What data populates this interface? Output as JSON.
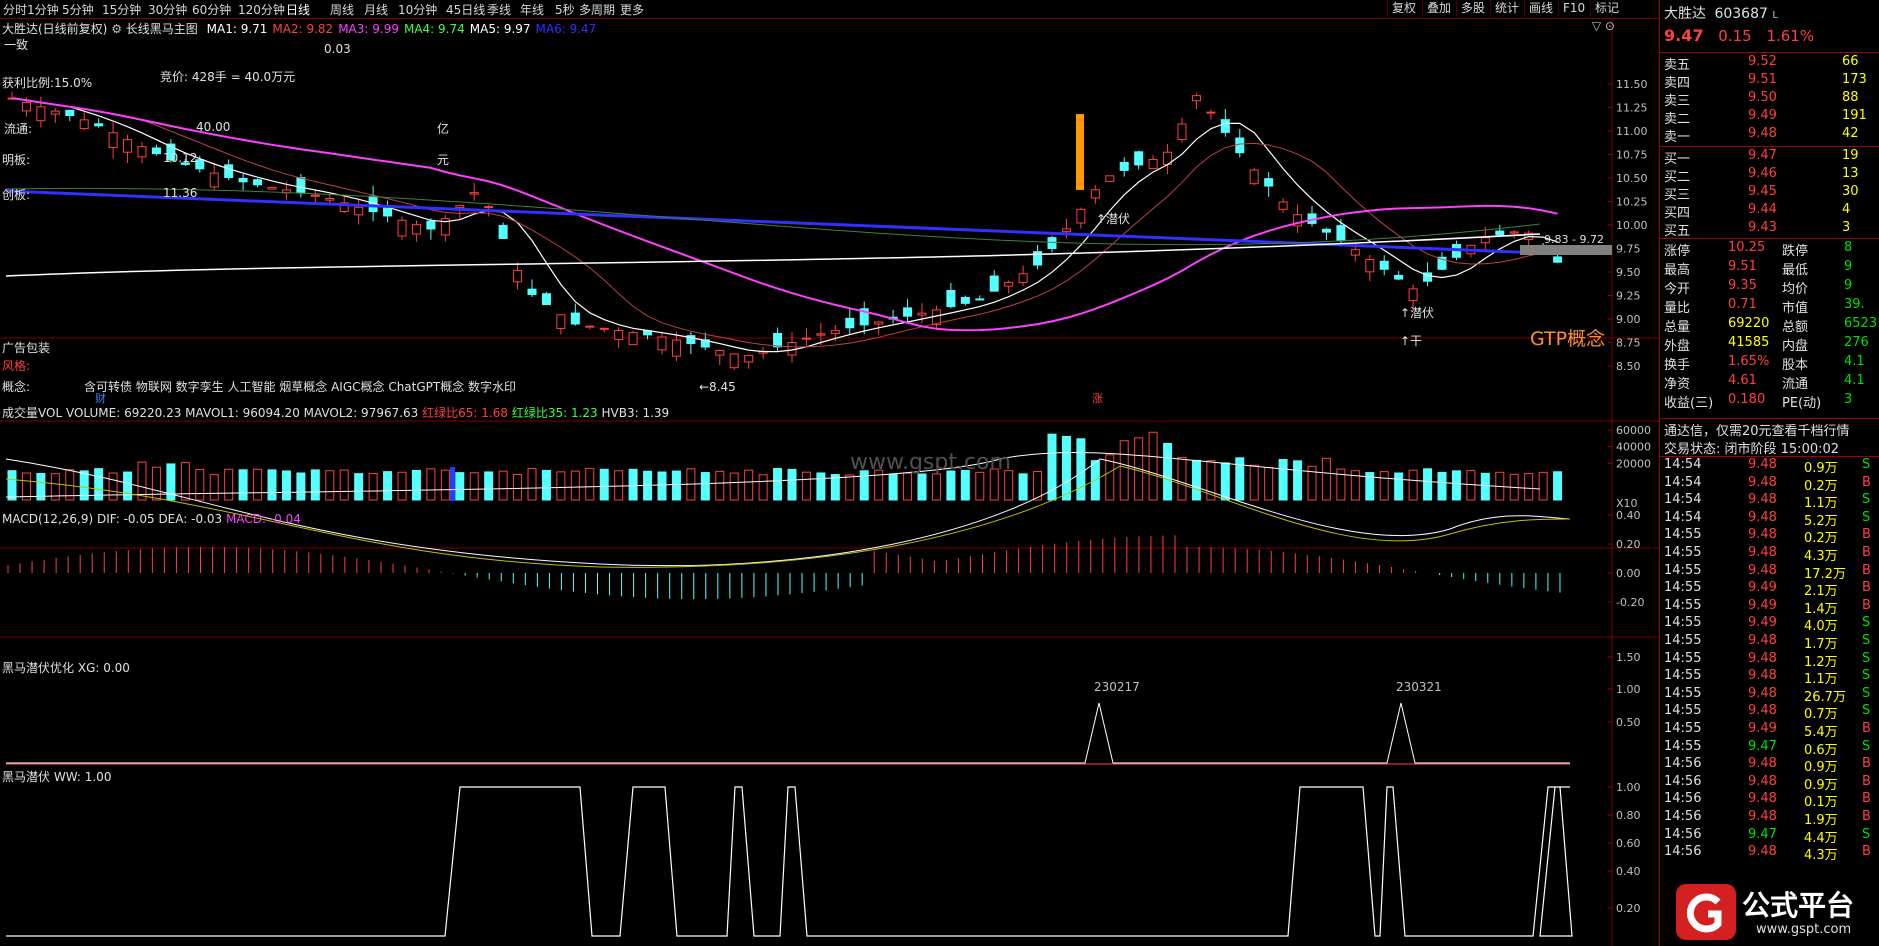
{
  "toolbar": {
    "periods": [
      "分时",
      "1分钟",
      "5分钟",
      "15分钟",
      "30分钟",
      "60分钟",
      "120分钟",
      "日线",
      "周线",
      "月线",
      "10分钟",
      "45日线",
      "季线",
      "年线",
      "5秒",
      "多周期",
      "更多"
    ],
    "actions": [
      "复权",
      "叠加",
      "多股",
      "统计",
      "画线",
      "F10",
      "标记"
    ]
  },
  "main": {
    "title": "大胜达(日线前复权)",
    "indicator": "长线黑马主图",
    "ma": [
      {
        "label": "MA1: 9.71",
        "color": "#ffffff"
      },
      {
        "label": "MA2: 9.82",
        "color": "#ff4040"
      },
      {
        "label": "MA3: 9.99",
        "color": "#ff40ff"
      },
      {
        "label": "MA4: 9.74",
        "color": "#40ff40"
      },
      {
        "label": "MA5: 9.97",
        "color": "#ffffff"
      },
      {
        "label": "MA6: 9.47",
        "color": "#3030ff"
      }
    ],
    "info": {
      "l1": "一致",
      "l2": "竞价: 428手 = 40.0万元",
      "l3": "获利比例:15.0%",
      "l4": "流通:",
      "l5": "明板:",
      "l6": "创板:",
      "v1": "0.03",
      "v2": "40.00",
      "v3": "10.12",
      "v4": "11.36",
      "y1": "亿",
      "y2": "元"
    },
    "ad": "广告包装",
    "style_label": "风格:",
    "concept_label": "概念:",
    "concepts": "含可转债 物联网 数字孪生 人工智能 烟草概念 AIGC概念 ChatGPT概念 数字水印",
    "gtp": "GTP概念",
    "annotations": {
      "low": "←8.45",
      "up1": "↑潜伏",
      "up2": "↑潜伏",
      "up3": "↑干",
      "pair": "9.83 - 9.72",
      "zhang": "涨",
      "cai": "财"
    },
    "y_axis": [
      "11.50",
      "11.25",
      "11.00",
      "10.75",
      "10.50",
      "10.25",
      "10.00",
      "9.75",
      "9.50",
      "9.25",
      "9.00",
      "8.75",
      "8.50"
    ]
  },
  "volume": {
    "title": "成交量VOL",
    "text1": "VOLUME: 69220.23  MAVOL1: 96094.20  MAVOL2: 97967.63",
    "text2": "红绿比65: 1.68",
    "text3": "红绿比35: 1.23",
    "text4": "HVB3: 1.39",
    "y_axis": [
      "60000",
      "40000",
      "20000"
    ],
    "unit": "X10",
    "watermark": "www.gspt.com"
  },
  "macd": {
    "title": "MACD(12,26,9)",
    "text1": "DIF: -0.05  DEA: -0.03",
    "text2": "MACD: -0.04",
    "y_axis": [
      "0.40",
      "0.20",
      "0.00",
      "-0.20"
    ]
  },
  "xg": {
    "title": "黑马潜伏优化",
    "text": "XG: 0.00",
    "labels": [
      "230217",
      "230321"
    ],
    "y_axis": [
      "1.50",
      "1.00",
      "0.50"
    ]
  },
  "ww": {
    "title": "黑马潜伏",
    "text": "WW: 1.00",
    "y_axis": [
      "1.00",
      "0.80",
      "0.60",
      "0.40",
      "0.20"
    ]
  },
  "panel": {
    "name": "大胜达",
    "code": "603687",
    "price": "9.47",
    "change": "0.15",
    "pct": "1.61%",
    "asks": [
      {
        "label": "卖五",
        "price": "9.52",
        "vol": "66"
      },
      {
        "label": "卖四",
        "price": "9.51",
        "vol": "173"
      },
      {
        "label": "卖三",
        "price": "9.50",
        "vol": "88"
      },
      {
        "label": "卖二",
        "price": "9.49",
        "vol": "191"
      },
      {
        "label": "卖一",
        "price": "9.48",
        "vol": "42"
      }
    ],
    "bids": [
      {
        "label": "买一",
        "price": "9.47",
        "vol": "19"
      },
      {
        "label": "买二",
        "price": "9.46",
        "vol": "13"
      },
      {
        "label": "买三",
        "price": "9.45",
        "vol": "30"
      },
      {
        "label": "买四",
        "price": "9.44",
        "vol": "4"
      },
      {
        "label": "买五",
        "price": "9.43",
        "vol": "3"
      }
    ],
    "stats": [
      {
        "l1": "涨停",
        "v1": "10.25",
        "l2": "跌停",
        "v2": "8"
      },
      {
        "l1": "最高",
        "v1": "9.51",
        "l2": "最低",
        "v2": "9"
      },
      {
        "l1": "今开",
        "v1": "9.35",
        "l2": "均价",
        "v2": "9"
      },
      {
        "l1": "量比",
        "v1": "0.71",
        "l2": "市值",
        "v2": "39."
      },
      {
        "l1": "总量",
        "v1": "69220",
        "l2": "总额",
        "v2": "6523"
      },
      {
        "l1": "外盘",
        "v1": "41585",
        "l2": "内盘",
        "v2": "276"
      },
      {
        "l1": "换手",
        "v1": "1.65%",
        "l2": "股本",
        "v2": "4.1"
      },
      {
        "l1": "净资",
        "v1": "4.61",
        "l2": "流通",
        "v2": "4.1"
      },
      {
        "l1": "收益(三)",
        "v1": "0.180",
        "l2": "PE(动)",
        "v2": "3"
      }
    ],
    "notice": "通达信，仅需20元查看千档行情",
    "trade_status": "交易状态: 闭市阶段 15:00:02",
    "ticks": [
      {
        "t": "14:54",
        "p": "9.48",
        "v": "0.9万",
        "d": "S"
      },
      {
        "t": "14:54",
        "p": "9.48",
        "v": "0.2万",
        "d": "B"
      },
      {
        "t": "14:54",
        "p": "9.48",
        "v": "1.1万",
        "d": "S"
      },
      {
        "t": "14:54",
        "p": "9.48",
        "v": "5.2万",
        "d": "S"
      },
      {
        "t": "14:55",
        "p": "9.48",
        "v": "0.2万",
        "d": "B"
      },
      {
        "t": "14:55",
        "p": "9.48",
        "v": "4.3万",
        "d": "B"
      },
      {
        "t": "14:55",
        "p": "9.48",
        "v": "17.2万",
        "d": "B"
      },
      {
        "t": "14:55",
        "p": "9.49",
        "v": "2.1万",
        "d": "B"
      },
      {
        "t": "14:55",
        "p": "9.49",
        "v": "1.4万",
        "d": "B"
      },
      {
        "t": "14:55",
        "p": "9.49",
        "v": "4.0万",
        "d": "S"
      },
      {
        "t": "14:55",
        "p": "9.48",
        "v": "1.7万",
        "d": "S"
      },
      {
        "t": "14:55",
        "p": "9.48",
        "v": "1.2万",
        "d": "S"
      },
      {
        "t": "14:55",
        "p": "9.48",
        "v": "1.1万",
        "d": "S"
      },
      {
        "t": "14:55",
        "p": "9.48",
        "v": "26.7万",
        "d": "S"
      },
      {
        "t": "14:55",
        "p": "9.48",
        "v": "0.7万",
        "d": "S"
      },
      {
        "t": "14:55",
        "p": "9.49",
        "v": "5.4万",
        "d": "B"
      },
      {
        "t": "14:55",
        "p": "9.47",
        "v": "0.6万",
        "d": "S"
      },
      {
        "t": "14:56",
        "p": "9.48",
        "v": "0.9万",
        "d": "B"
      },
      {
        "t": "14:56",
        "p": "9.48",
        "v": "0.9万",
        "d": "B"
      },
      {
        "t": "14:56",
        "p": "9.48",
        "v": "0.1万",
        "d": "B"
      },
      {
        "t": "14:56",
        "p": "9.48",
        "v": "1.9万",
        "d": "B"
      },
      {
        "t": "14:56",
        "p": "9.47",
        "v": "4.4万",
        "d": "S"
      },
      {
        "t": "14:56",
        "p": "9.48",
        "v": "4.3万",
        "d": "B"
      }
    ],
    "logo_text": "公式平台",
    "logo_url": "www.gspt.com"
  }
}
